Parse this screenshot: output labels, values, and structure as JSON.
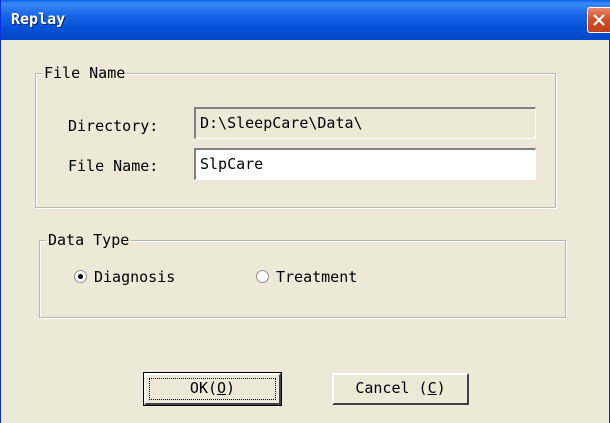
{
  "window": {
    "title": "Replay"
  },
  "file_group": {
    "legend": "File Name",
    "directory_label": "Directory:",
    "directory_value": "D:\\SleepCare\\Data\\",
    "filename_label": "File Name:",
    "filename_value": "SlpCare"
  },
  "type_group": {
    "legend": "Data Type",
    "options": [
      {
        "label": "Diagnosis",
        "selected": true
      },
      {
        "label": "Treatment",
        "selected": false
      }
    ]
  },
  "buttons": {
    "ok_prefix": "OK(",
    "ok_mnemonic": "O",
    "ok_suffix": ")",
    "cancel_prefix": "Cancel (",
    "cancel_mnemonic": "C",
    "cancel_suffix": ")"
  },
  "colors": {
    "titlebar": "#0552d8",
    "face": "#ece9d8",
    "close": "#d5502c"
  }
}
